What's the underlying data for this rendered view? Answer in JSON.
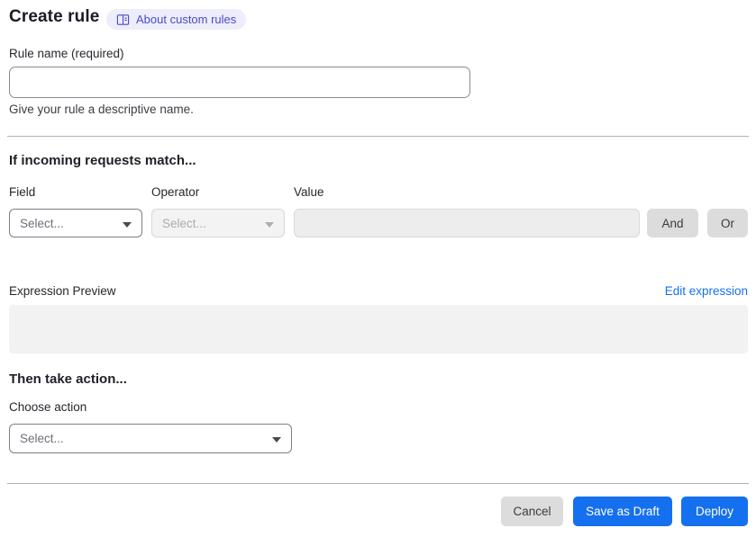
{
  "header": {
    "title": "Create rule",
    "badge": {
      "label": "About custom rules",
      "icon": "book-icon"
    }
  },
  "rule_name": {
    "label": "Rule name (required)",
    "value": "",
    "helper": "Give your rule a descriptive name."
  },
  "match_section": {
    "heading": "If incoming requests match...",
    "field": {
      "label": "Field",
      "placeholder": "Select..."
    },
    "operator": {
      "label": "Operator",
      "placeholder": "Select..."
    },
    "value": {
      "label": "Value",
      "value": ""
    },
    "and_button": "And",
    "or_button": "Or"
  },
  "expression": {
    "label": "Expression Preview",
    "edit_link": "Edit expression",
    "content": ""
  },
  "action_section": {
    "heading": "Then take action...",
    "choose_label": "Choose action",
    "placeholder": "Select..."
  },
  "footer": {
    "cancel": "Cancel",
    "save_draft": "Save as Draft",
    "deploy": "Deploy"
  },
  "colors": {
    "primary_blue": "#1570ef",
    "link_blue": "#1570ef",
    "badge_bg": "#ededfb",
    "badge_text": "#4a4cc8"
  }
}
